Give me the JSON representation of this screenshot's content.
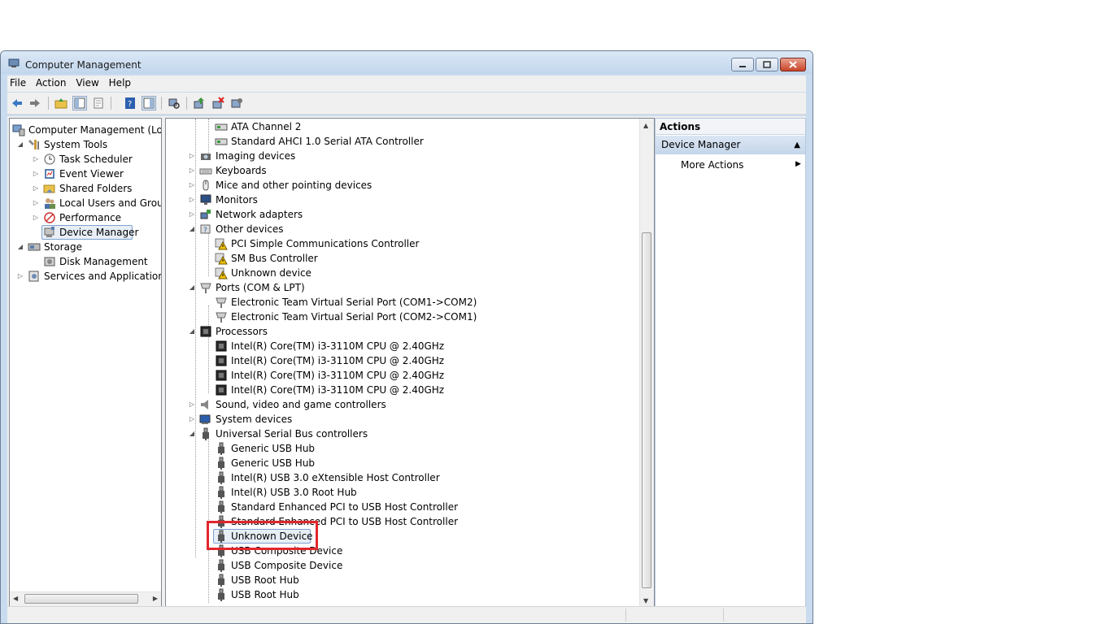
{
  "window": {
    "title": "Computer Management"
  },
  "menu": [
    "File",
    "Action",
    "View",
    "Help"
  ],
  "left_tree": [
    {
      "label": "Computer Management (Local",
      "level": 0,
      "expander": "",
      "icon": "computer-management-icon"
    },
    {
      "label": "System Tools",
      "level": 1,
      "expander": "expanded",
      "icon": "system-tools-icon"
    },
    {
      "label": "Task Scheduler",
      "level": 2,
      "expander": "collapsed",
      "icon": "clock-icon"
    },
    {
      "label": "Event Viewer",
      "level": 2,
      "expander": "collapsed",
      "icon": "event-viewer-icon"
    },
    {
      "label": "Shared Folders",
      "level": 2,
      "expander": "collapsed",
      "icon": "shared-folder-icon"
    },
    {
      "label": "Local Users and Groups",
      "level": 2,
      "expander": "collapsed",
      "icon": "users-icon"
    },
    {
      "label": "Performance",
      "level": 2,
      "expander": "collapsed",
      "icon": "performance-icon"
    },
    {
      "label": "Device Manager",
      "level": 2,
      "expander": "",
      "icon": "device-manager-icon",
      "selected": true
    },
    {
      "label": "Storage",
      "level": 1,
      "expander": "expanded",
      "icon": "storage-icon"
    },
    {
      "label": "Disk Management",
      "level": 2,
      "expander": "",
      "icon": "disk-icon"
    },
    {
      "label": "Services and Applications",
      "level": 1,
      "expander": "collapsed",
      "icon": "services-icon"
    }
  ],
  "device_tree": [
    {
      "label": "ATA Channel 2",
      "level": 1,
      "expander": "",
      "icon": "ide-controller-icon"
    },
    {
      "label": "Standard AHCI 1.0 Serial ATA Controller",
      "level": 1,
      "expander": "",
      "icon": "ide-controller-icon"
    },
    {
      "label": "Imaging devices",
      "level": 0,
      "expander": "collapsed",
      "icon": "camera-icon"
    },
    {
      "label": "Keyboards",
      "level": 0,
      "expander": "collapsed",
      "icon": "keyboard-icon"
    },
    {
      "label": "Mice and other pointing devices",
      "level": 0,
      "expander": "collapsed",
      "icon": "mouse-icon"
    },
    {
      "label": "Monitors",
      "level": 0,
      "expander": "collapsed",
      "icon": "monitor-icon"
    },
    {
      "label": "Network adapters",
      "level": 0,
      "expander": "collapsed",
      "icon": "network-adapter-icon"
    },
    {
      "label": "Other devices",
      "level": 0,
      "expander": "expanded",
      "icon": "unknown-device-category-icon"
    },
    {
      "label": "PCI Simple Communications Controller",
      "level": 1,
      "expander": "",
      "icon": "warning-device-icon"
    },
    {
      "label": "SM Bus Controller",
      "level": 1,
      "expander": "",
      "icon": "warning-device-icon"
    },
    {
      "label": "Unknown device",
      "level": 1,
      "expander": "",
      "icon": "warning-device-icon"
    },
    {
      "label": "Ports (COM & LPT)",
      "level": 0,
      "expander": "expanded",
      "icon": "port-icon"
    },
    {
      "label": "Electronic Team Virtual Serial Port (COM1->COM2)",
      "level": 1,
      "expander": "",
      "icon": "port-icon"
    },
    {
      "label": "Electronic Team Virtual Serial Port (COM2->COM1)",
      "level": 1,
      "expander": "",
      "icon": "port-icon"
    },
    {
      "label": "Processors",
      "level": 0,
      "expander": "expanded",
      "icon": "processor-icon"
    },
    {
      "label": "Intel(R) Core(TM) i3-3110M CPU @ 2.40GHz",
      "level": 1,
      "expander": "",
      "icon": "processor-icon"
    },
    {
      "label": "Intel(R) Core(TM) i3-3110M CPU @ 2.40GHz",
      "level": 1,
      "expander": "",
      "icon": "processor-icon"
    },
    {
      "label": "Intel(R) Core(TM) i3-3110M CPU @ 2.40GHz",
      "level": 1,
      "expander": "",
      "icon": "processor-icon"
    },
    {
      "label": "Intel(R) Core(TM) i3-3110M CPU @ 2.40GHz",
      "level": 1,
      "expander": "",
      "icon": "processor-icon"
    },
    {
      "label": "Sound, video and game controllers",
      "level": 0,
      "expander": "collapsed",
      "icon": "speaker-icon"
    },
    {
      "label": "System devices",
      "level": 0,
      "expander": "collapsed",
      "icon": "system-device-icon"
    },
    {
      "label": "Universal Serial Bus controllers",
      "level": 0,
      "expander": "expanded",
      "icon": "usb-icon"
    },
    {
      "label": "Generic USB Hub",
      "level": 1,
      "expander": "",
      "icon": "usb-icon"
    },
    {
      "label": "Generic USB Hub",
      "level": 1,
      "expander": "",
      "icon": "usb-icon"
    },
    {
      "label": "Intel(R) USB 3.0 eXtensible Host Controller",
      "level": 1,
      "expander": "",
      "icon": "usb-icon"
    },
    {
      "label": "Intel(R) USB 3.0 Root Hub",
      "level": 1,
      "expander": "",
      "icon": "usb-icon"
    },
    {
      "label": "Standard Enhanced PCI to USB Host Controller",
      "level": 1,
      "expander": "",
      "icon": "usb-icon"
    },
    {
      "label": "Standard Enhanced PCI to USB Host Controller",
      "level": 1,
      "expander": "",
      "icon": "usb-icon"
    },
    {
      "label": "Unknown Device",
      "level": 1,
      "expander": "",
      "icon": "usb-icon",
      "selected": true
    },
    {
      "label": "USB Composite Device",
      "level": 1,
      "expander": "",
      "icon": "usb-icon"
    },
    {
      "label": "USB Composite Device",
      "level": 1,
      "expander": "",
      "icon": "usb-icon"
    },
    {
      "label": "USB Root Hub",
      "level": 1,
      "expander": "",
      "icon": "usb-icon"
    },
    {
      "label": "USB Root Hub",
      "level": 1,
      "expander": "",
      "icon": "usb-icon"
    }
  ],
  "actions": {
    "header": "Actions",
    "section": "Device Manager",
    "more": "More Actions"
  },
  "colors": {
    "highlight": "#e2262b",
    "title_bg": "#c9dbee",
    "selection_border": "#7da2ce"
  }
}
